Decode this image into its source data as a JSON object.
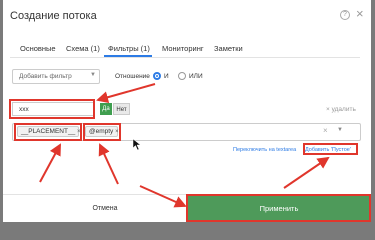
{
  "dialog": {
    "title": "Создание потока",
    "help_icon": "?",
    "close_icon": "×"
  },
  "tabs": [
    {
      "label": "Основные"
    },
    {
      "label": "Схема (1)"
    },
    {
      "label": "Фильтры (1)",
      "active": true
    },
    {
      "label": "Мониторинг"
    },
    {
      "label": "Заметки"
    }
  ],
  "filters": {
    "add_filter_placeholder": "Добавить фильтр",
    "relation_label": "Отношение",
    "relation_and": "И",
    "relation_or": "ИЛИ",
    "relation_selected": "И",
    "filter_value": "xxx",
    "yes_label": "Да",
    "no_label": "Нет",
    "delete_label": "× удалить",
    "tags": [
      {
        "label": "__PLACEMENT__",
        "remove": "×"
      },
      {
        "label": "@empty",
        "remove": "×"
      }
    ],
    "switch_textarea_label": "Переключить на textarea",
    "add_empty_label": "Добавить 'Пустое'"
  },
  "footer": {
    "cancel_label": "Отмена",
    "apply_label": "Применить"
  },
  "colors": {
    "overlay": "#7a7a7a",
    "accent_blue": "#2c7be5",
    "apply_green": "#4e9a5a",
    "yes_green": "#3f9e4f",
    "annotation_red": "#e0362c"
  },
  "icons": {
    "help": "help-icon",
    "close": "close-icon",
    "select_caret": "chevron-down-icon",
    "cursor": "mouse-cursor-icon"
  }
}
